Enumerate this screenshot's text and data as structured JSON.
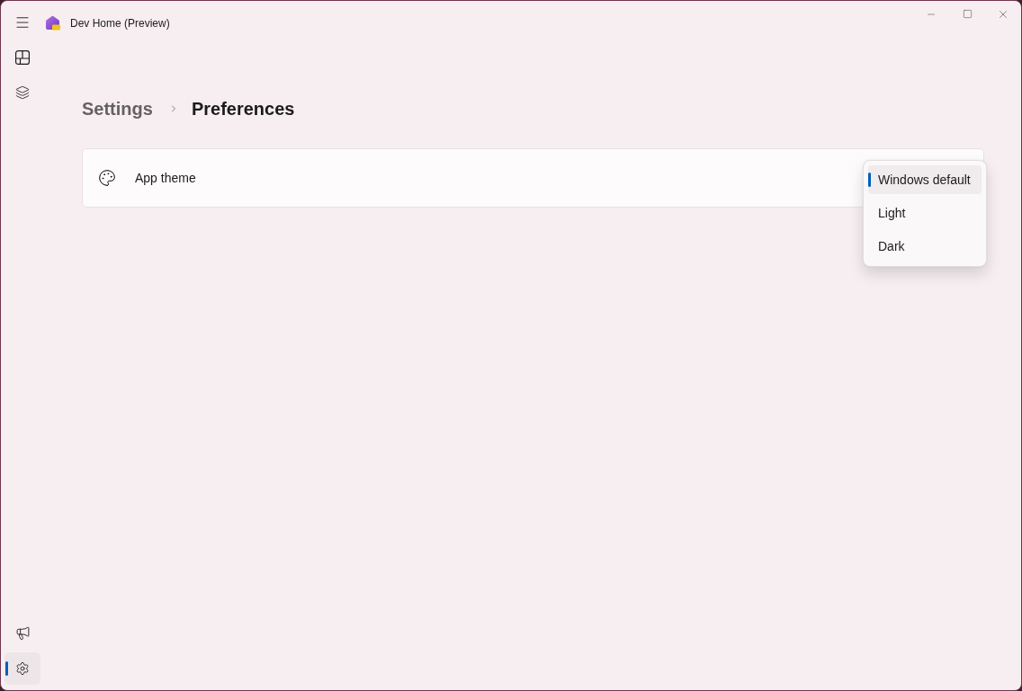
{
  "window": {
    "title": "Dev Home (Preview)"
  },
  "nav": {
    "top_items": [
      {
        "kind": "dashboard",
        "selected": false
      },
      {
        "kind": "layers",
        "selected": false
      }
    ],
    "bottom_items": [
      {
        "kind": "megaphone",
        "selected": false
      },
      {
        "kind": "settings",
        "selected": true
      }
    ]
  },
  "breadcrumb": [
    {
      "label": "Settings",
      "current": false
    },
    {
      "label": "Preferences",
      "current": true
    }
  ],
  "settings": [
    {
      "label": "App theme"
    }
  ],
  "theme_menu": {
    "options": [
      {
        "label": "Windows default",
        "selected": true
      },
      {
        "label": "Light",
        "selected": false
      },
      {
        "label": "Dark",
        "selected": false
      }
    ]
  }
}
